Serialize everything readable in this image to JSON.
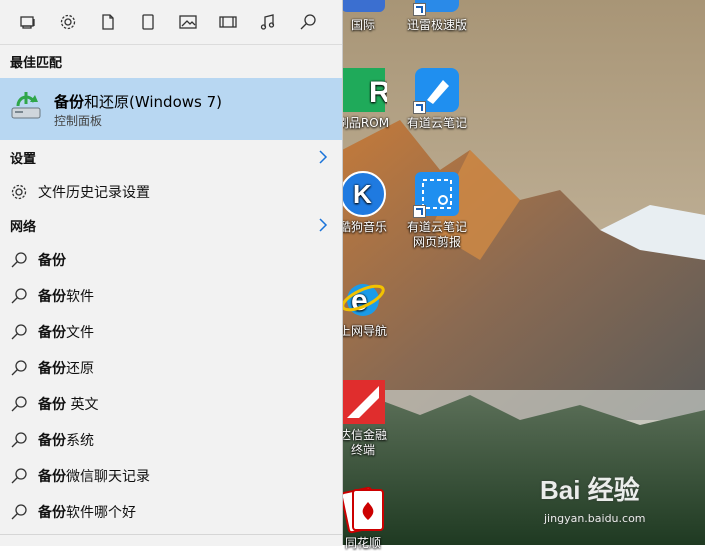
{
  "filter_bar": {
    "icons": [
      "apps-icon",
      "settings-gear-icon",
      "document-icon",
      "phone-tablet-icon",
      "photo-icon",
      "video-icon",
      "music-icon",
      "web-search-icon"
    ]
  },
  "sections": {
    "best_match": "最佳匹配",
    "settings": "设置",
    "web": "网络"
  },
  "best_match_item": {
    "title_bold": "备份",
    "title_rest": "和还原(Windows 7)",
    "subtitle": "控制面板"
  },
  "settings_items": [
    {
      "label": "文件历史记录设置"
    }
  ],
  "web_items": [
    {
      "bold": "备份",
      "rest": ""
    },
    {
      "bold": "备份",
      "rest": "软件"
    },
    {
      "bold": "备份",
      "rest": "文件"
    },
    {
      "bold": "备份",
      "rest": "还原"
    },
    {
      "bold": "备份",
      "rest": " 英文"
    },
    {
      "bold": "备份",
      "rest": "系统"
    },
    {
      "bold": "备份",
      "rest": "微信聊天记录"
    },
    {
      "bold": "备份",
      "rest": "软件哪个好"
    }
  ],
  "desktop_icons": [
    {
      "label": "国际"
    },
    {
      "label": "迅雷极速版"
    },
    {
      "label": "刷品ROM"
    },
    {
      "label": "有道云笔记"
    },
    {
      "label": "酷狗音乐"
    },
    {
      "label": "有道云笔记\n网页剪报"
    },
    {
      "label": "上网导航"
    },
    {
      "label": "达信金融\n终端"
    },
    {
      "label": "同花顺"
    }
  ],
  "watermark": {
    "brand": "Bai 经验",
    "site": "jingyan.baidu.com"
  },
  "colors": {
    "panel_bg": "#f2f2f2",
    "highlight_bg": "#b8d7f2",
    "accent": "#1a73d9"
  }
}
